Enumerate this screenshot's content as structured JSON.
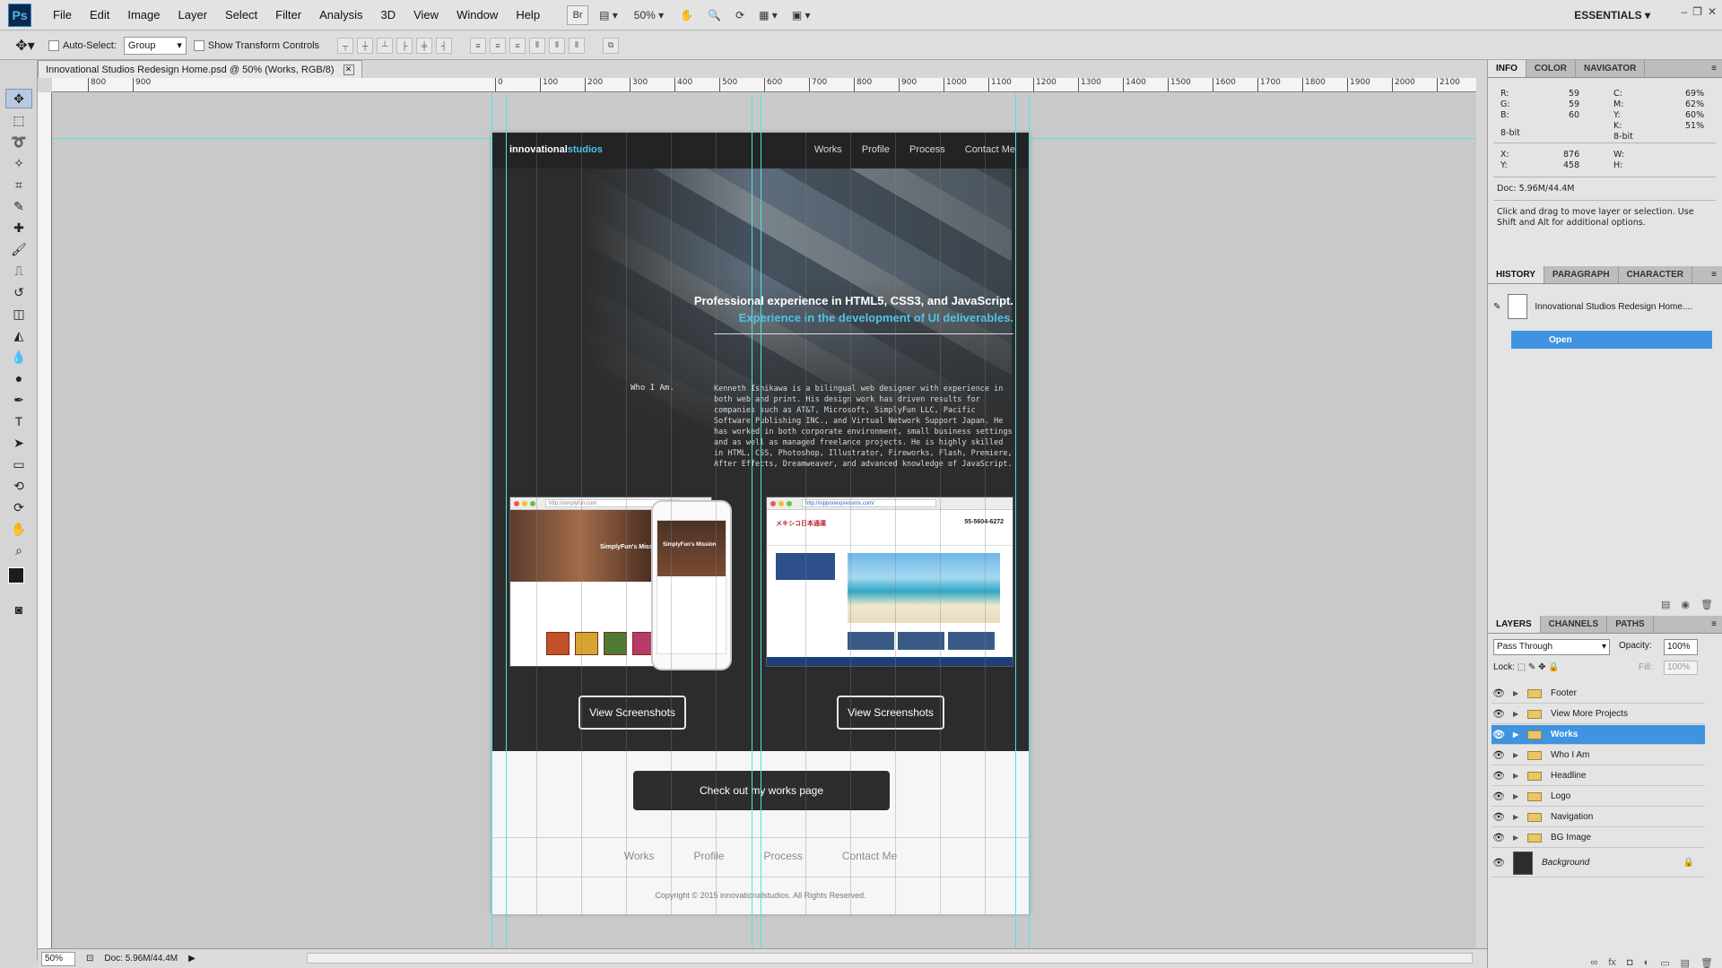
{
  "menubar": {
    "app_icon": "Ps",
    "items": [
      "File",
      "Edit",
      "Image",
      "Layer",
      "Select",
      "Filter",
      "Analysis",
      "3D",
      "View",
      "Window",
      "Help"
    ],
    "zoom": "50%",
    "workspace": "ESSENTIALS"
  },
  "options": {
    "auto_select_label": "Auto-Select:",
    "auto_select_value": "Group",
    "transform_label": "Show Transform Controls"
  },
  "document": {
    "tab_title": "Innovational Studios Redesign Home.psd @ 50% (Works, RGB/8)",
    "ruler_ticks": [
      "800",
      "900",
      "0",
      "100",
      "200",
      "300",
      "400",
      "500",
      "600",
      "700",
      "800",
      "900",
      "1000",
      "1100",
      "1200",
      "1300",
      "1400",
      "1500",
      "1600",
      "1700",
      "1800",
      "1900",
      "2000",
      "2100"
    ]
  },
  "site": {
    "logo_main": "innovational",
    "logo_accent": "studios",
    "nav": [
      "Works",
      "Profile",
      "Process",
      "Contact Me"
    ],
    "headline_1": "Professional experience in HTML5, CSS3, and JavaScript.",
    "headline_2": "Experience in the development of UI deliverables.",
    "who_label": "Who I Am.",
    "who_body": "Kenneth Ishikawa is a bilingual web designer with experience in both web and print. His design work has driven results for companies such as AT&T, Microsoft, SimplyFun LLC, Pacific Software Publishing INC., and Virtual Network Support Japan. He has worked in both corporate environment, small business settings and as well as managed freelance projects. He is highly skilled in HTML, CSS, Photoshop, Illustrator, Fireworks, Flash, Premiere, After Effects, Dreamweaver, and advanced knowledge of JavaScript.",
    "shot1_url": "http://simplyfun.com",
    "shot1_mission": "SimplyFun's Mission",
    "phone_mission": "SimplyFun's Mission",
    "shot2_url": "http://nipponexpressmx.com/",
    "shot2_logo": "メキシコ日本通運",
    "shot2_phone": "55-5604-6272",
    "view_screenshots": "View Screenshots",
    "cta": "Check out my works page",
    "footer_nav": [
      "Works",
      "Profile",
      "Process",
      "Contact Me"
    ],
    "copyright": "Copyright © 2015 innovationalstudios. All Rights Reserved."
  },
  "info_panel": {
    "tabs": [
      "INFO",
      "COLOR",
      "NAVIGATOR"
    ],
    "r": "59",
    "g": "59",
    "b": "60",
    "c": "69%",
    "m": "62%",
    "y": "60%",
    "k": "51%",
    "bit_left": "8-bit",
    "bit_right": "8-bit",
    "x": "876",
    "y_coord": "458",
    "doc": "Doc: 5.96M/44.4M",
    "hint": "Click and drag to move layer or selection.  Use Shift and Alt for additional options."
  },
  "history_panel": {
    "tabs": [
      "HISTORY",
      "PARAGRAPH",
      "CHARACTER"
    ],
    "snapshot": "Innovational Studios Redesign Home....",
    "open": "Open"
  },
  "layers_panel": {
    "tabs": [
      "LAYERS",
      "CHANNELS",
      "PATHS"
    ],
    "blend_mode": "Pass Through",
    "opacity_label": "Opacity:",
    "opacity": "100%",
    "lock_label": "Lock:",
    "fill_label": "Fill:",
    "fill": "100%",
    "layers": [
      "Footer",
      "View More Projects",
      "Works",
      "Who I Am",
      "Headline",
      "Logo",
      "Navigation",
      "BG Image"
    ],
    "selected": "Works",
    "background": "Background"
  },
  "status": {
    "zoom": "50%",
    "doc": "Doc: 5.96M/44.4M"
  },
  "colors": {
    "accent": "#4fc3e8",
    "selection": "#3f93e0",
    "guide": "#54e0e6",
    "site_dark": "#2c2c2c"
  }
}
